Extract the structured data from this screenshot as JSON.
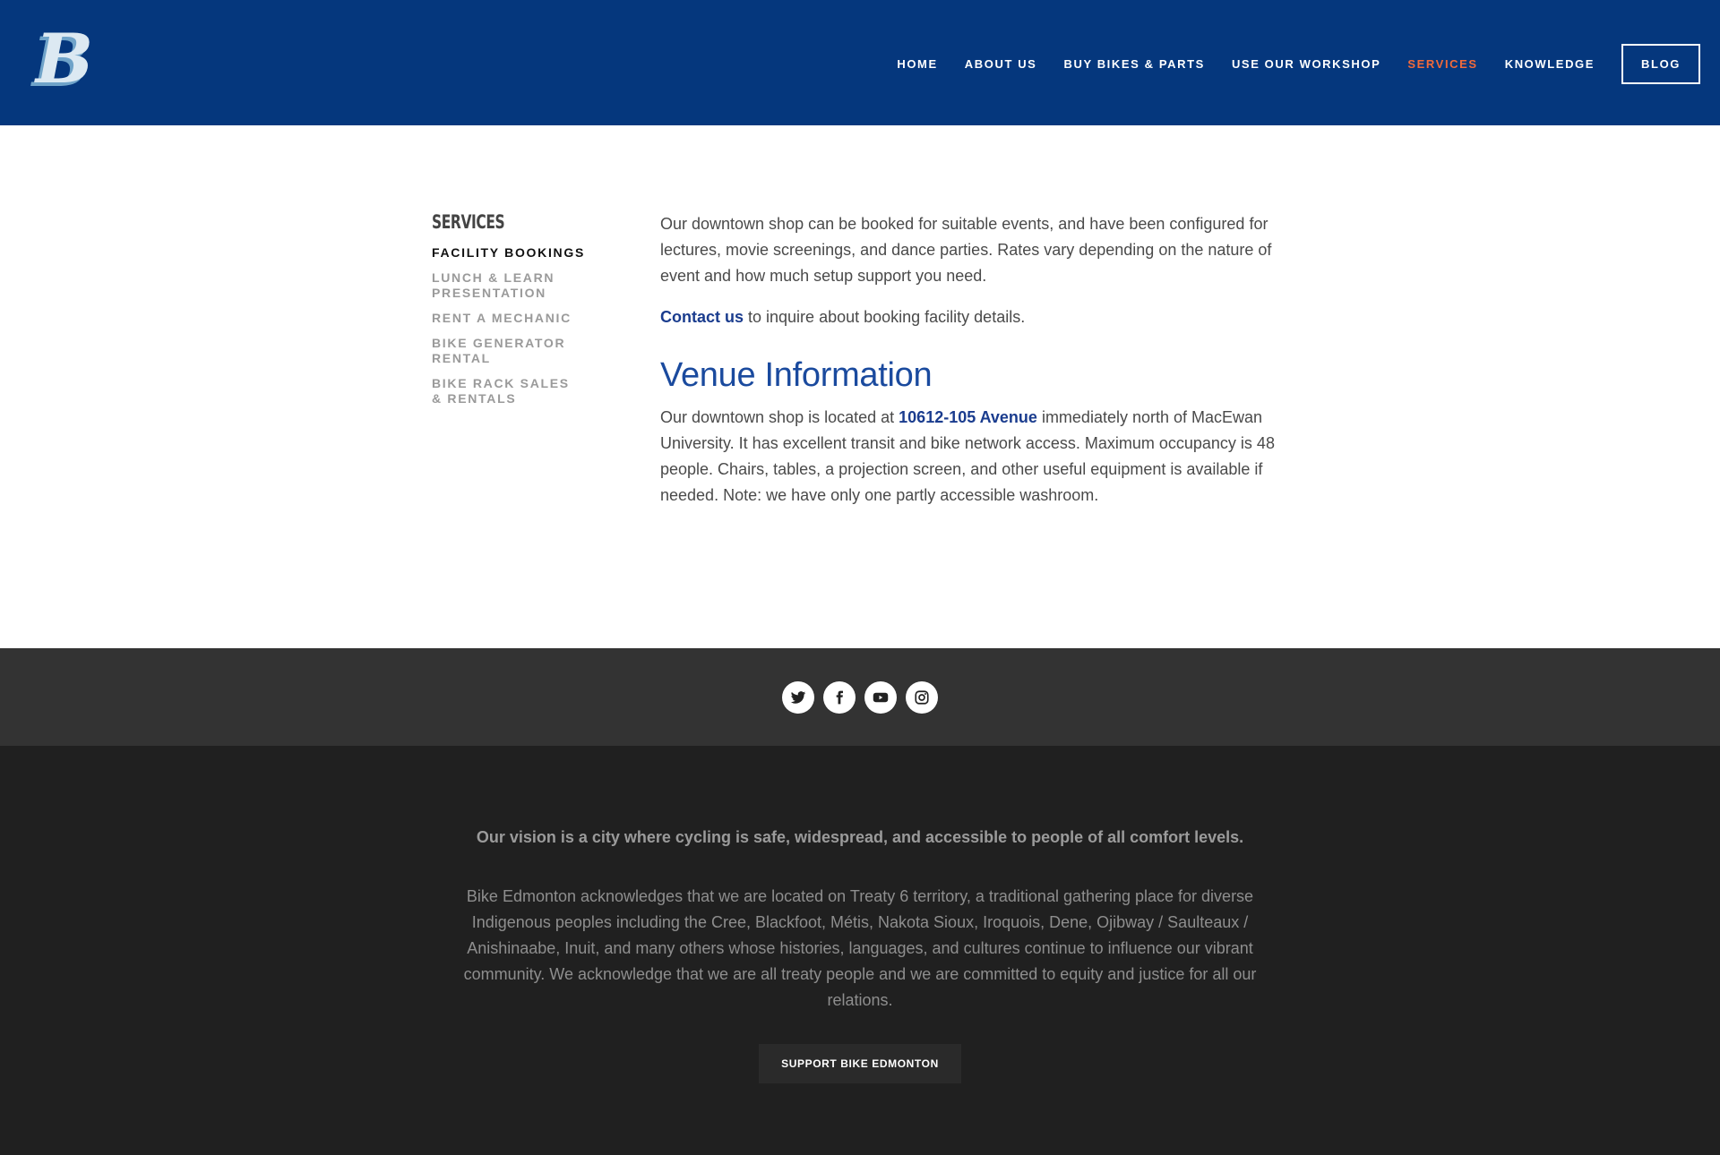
{
  "header": {
    "logo_alt": "B",
    "nav": [
      {
        "label": "HOME",
        "active": false
      },
      {
        "label": "ABOUT US",
        "active": false
      },
      {
        "label": "BUY BIKES & PARTS",
        "active": false
      },
      {
        "label": "USE OUR WORKSHOP",
        "active": false
      },
      {
        "label": "SERVICES",
        "active": true
      },
      {
        "label": "KNOWLEDGE",
        "active": false
      }
    ],
    "blog_label": "BLOG",
    "bg_color": "#05377d",
    "active_color": "#f26a3a"
  },
  "sidebar": {
    "title": "SERVICES",
    "items": [
      {
        "label": "FACILITY BOOKINGS",
        "current": true
      },
      {
        "label": "LUNCH & LEARN PRESENTATION",
        "current": false
      },
      {
        "label": "RENT A MECHANIC",
        "current": false
      },
      {
        "label": "BIKE GENERATOR RENTAL",
        "current": false
      },
      {
        "label": "BIKE RACK SALES & RENTALS",
        "current": false
      }
    ]
  },
  "content": {
    "intro": "Our downtown shop can be booked for suitable events, and have been configured for lectures, movie screenings, and dance parties. Rates vary depending on the nature of event and how much setup support you need.",
    "contact_link": "Contact us",
    "contact_rest": " to inquire about booking facility details.",
    "venue_heading": "Venue Information",
    "venue_pre": "Our downtown shop is located at ",
    "venue_address": "10612-105 Avenue",
    "venue_post": " immediately north of MacEwan University. It has excellent transit and bike network access. Maximum occupancy is 48 people. Chairs, tables, a projection screen, and other useful equipment is available if needed. Note: we have only one partly accessible washroom."
  },
  "social": {
    "icons": [
      "twitter-icon",
      "facebook-icon",
      "youtube-icon",
      "instagram-icon"
    ]
  },
  "footer": {
    "vision": "Our vision is a city where cycling is safe, widespread, and accessible to people of all comfort levels.",
    "acknowledgement": "Bike Edmonton acknowledges that we are located on Treaty 6 territory, a traditional gathering place for diverse Indigenous peoples including the Cree, Blackfoot, Métis, Nakota Sioux, Iroquois, Dene, Ojibway / Saulteaux / Anishinaabe, Inuit, and many others whose histories, languages, and cultures continue to influence our vibrant community. We acknowledge that we are all treaty people and we are committed to equity and justice for all our relations.",
    "support_label": "SUPPORT BIKE EDMONTON"
  }
}
